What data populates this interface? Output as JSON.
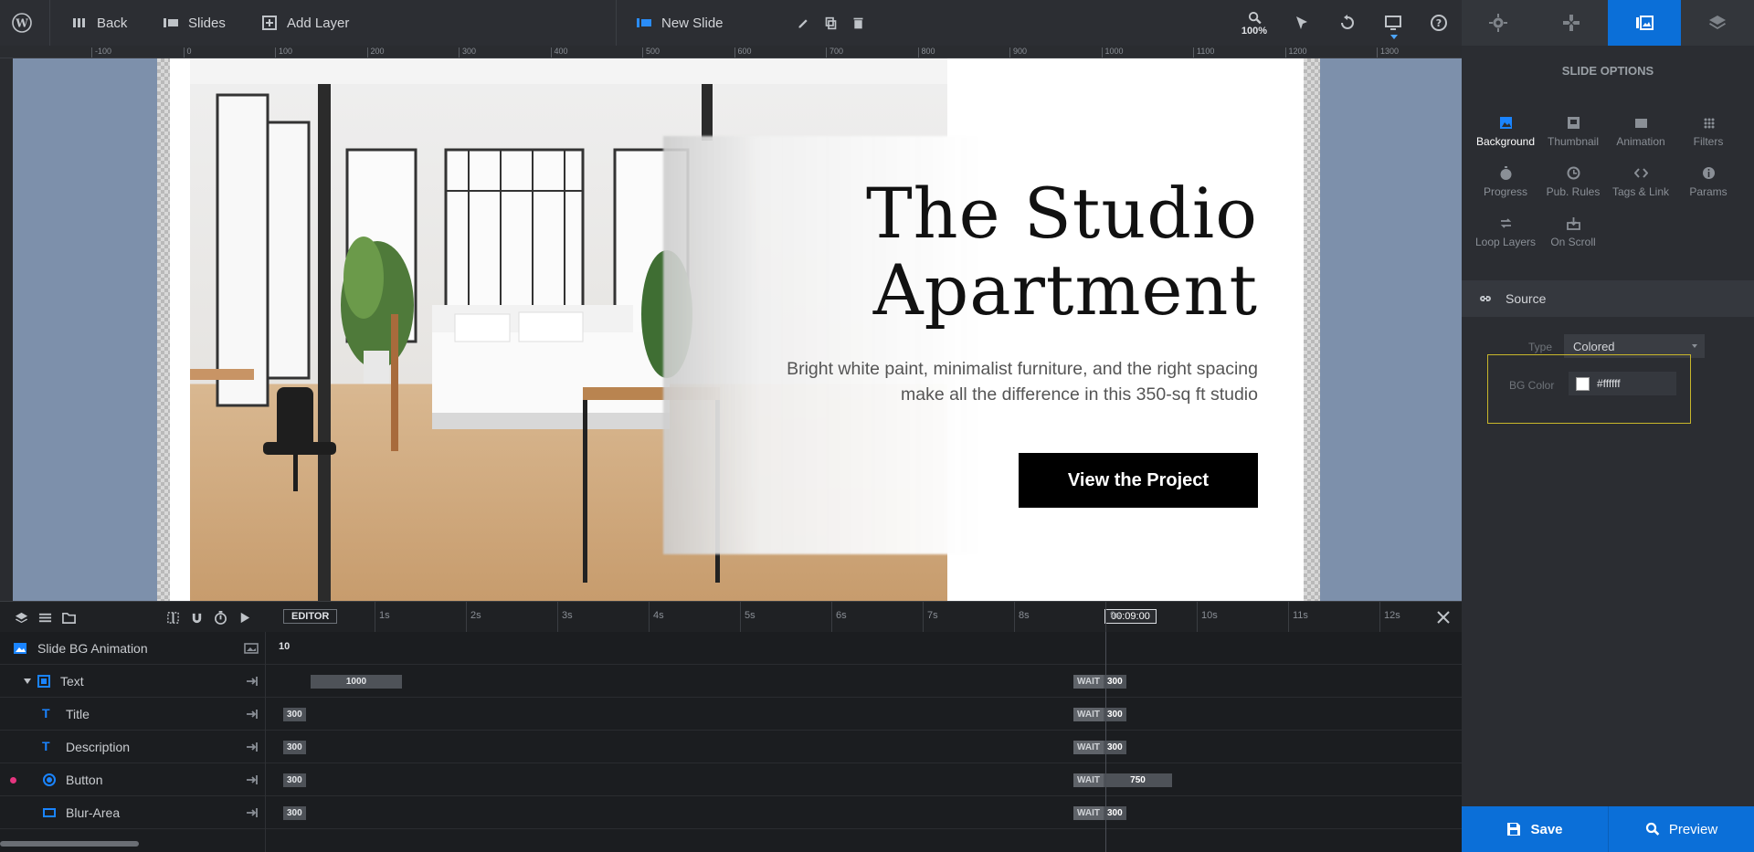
{
  "topbar": {
    "back_label": "Back",
    "slides_label": "Slides",
    "add_layer_label": "Add Layer",
    "slide_name": "New Slide",
    "zoom": "100%"
  },
  "ruler": {
    "h_labels": [
      "-100",
      "0",
      "100",
      "200",
      "300",
      "400",
      "500",
      "600",
      "700",
      "800",
      "900",
      "1000",
      "1100",
      "1200",
      "1300"
    ]
  },
  "slide": {
    "title_line1": "The Studio",
    "title_line2": "Apartment",
    "desc_line1": "Bright white paint, minimalist furniture, and the right spacing",
    "desc_line2": "make all the difference in this 350-sq ft studio",
    "cta": "View the Project",
    "bg_color": "#ffffff",
    "canvas_color": "#7d90ab"
  },
  "timeline": {
    "editor_label": "EDITOR",
    "seconds": [
      "1s",
      "2s",
      "3s",
      "4s",
      "5s",
      "6s",
      "7s",
      "8s",
      "9s",
      "10s",
      "11s",
      "12s"
    ],
    "current_time": "00:09:00",
    "rows": [
      {
        "name": "Slide BG Animation",
        "start": "10",
        "wait": "",
        "end": ""
      },
      {
        "name": "Text",
        "start": "1000",
        "wait": "WAIT",
        "end": "300"
      },
      {
        "name": "Title",
        "start": "300",
        "wait": "WAIT",
        "end": "300"
      },
      {
        "name": "Description",
        "start": "300",
        "wait": "WAIT",
        "end": "300"
      },
      {
        "name": "Button",
        "start": "300",
        "wait": "WAIT",
        "end": "750"
      },
      {
        "name": "Blur-Area",
        "start": "300",
        "wait": "WAIT",
        "end": "300"
      }
    ]
  },
  "panel": {
    "title": "SLIDE OPTIONS",
    "options": [
      "Background",
      "Thumbnail",
      "Animation",
      "Filters",
      "Progress",
      "Pub. Rules",
      "Tags & Link",
      "Params",
      "Loop Layers",
      "On Scroll"
    ],
    "active_option": "Background",
    "source_label": "Source",
    "type_label": "Type",
    "type_value": "Colored",
    "bg_color_label": "BG Color",
    "bg_color_value": "#ffffff",
    "accent": "#0b6fd8"
  },
  "footer": {
    "save_label": "Save",
    "preview_label": "Preview"
  }
}
